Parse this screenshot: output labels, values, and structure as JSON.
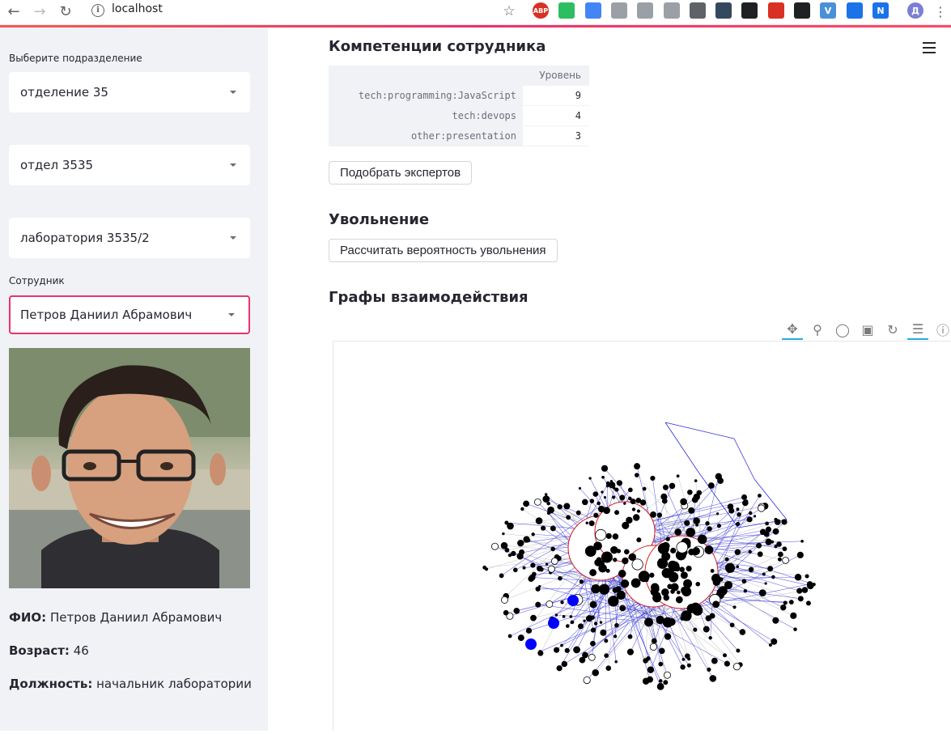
{
  "browser": {
    "url": "localhost",
    "extensions": [
      {
        "name": "adblock-icon",
        "label": "ABP",
        "color": "#d93025"
      },
      {
        "name": "evernote-icon",
        "label": "",
        "color": "#2dbe60"
      },
      {
        "name": "translate-icon",
        "label": "",
        "color": "#4285f4"
      },
      {
        "name": "vivaldi-icon",
        "label": "",
        "color": "#9aa0a6"
      },
      {
        "name": "star-plus-icon",
        "label": "",
        "color": "#9aa0a6"
      },
      {
        "name": "rss-icon",
        "label": "",
        "color": "#9aa0a6"
      },
      {
        "name": "ublock-icon",
        "label": "",
        "color": "#5f6368"
      },
      {
        "name": "spy-icon",
        "label": "",
        "color": "#34495e"
      },
      {
        "name": "crop-icon",
        "label": "",
        "color": "#202124"
      },
      {
        "name": "mega-icon",
        "label": "",
        "color": "#d93025"
      },
      {
        "name": "scissors-icon",
        "label": "",
        "color": "#202124"
      },
      {
        "name": "v-icon",
        "label": "V",
        "color": "#4a90d9"
      },
      {
        "name": "cloud-icon",
        "label": "",
        "color": "#1a73e8"
      },
      {
        "name": "notion-icon",
        "label": "N",
        "color": "#1a73e8"
      }
    ],
    "profile_initial": "Д"
  },
  "sidebar": {
    "division_label": "Выберите подразделение",
    "division_value": "отделение 35",
    "department_value": "отдел 3535",
    "lab_value": "лаборатория 3535/2",
    "employee_label": "Сотрудник",
    "employee_value": "Петров Даниил Абрамович",
    "fio_key": "ФИО:",
    "fio_value": "Петров Даниил Абрамович",
    "age_key": "Возраст:",
    "age_value": "46",
    "position_key": "Должность:",
    "position_value": "начальник лаборатории"
  },
  "main": {
    "competencies_title": "Компетенции сотрудника",
    "table_header": "Уровень",
    "table_rows": [
      {
        "skill": "tech:programming:JavaScript",
        "level": "9"
      },
      {
        "skill": "tech:devops",
        "level": "4"
      },
      {
        "skill": "other:presentation",
        "level": "3"
      }
    ],
    "find_experts_label": "Подобрать экспертов",
    "dismissal_title": "Увольнение",
    "dismissal_button_label": "Рассчитать вероятность увольнения",
    "graphs_title": "Графы взаимодействия",
    "graph_tools": [
      "pan-icon",
      "box-zoom-icon",
      "wheel-zoom-icon",
      "save-icon",
      "reset-icon",
      "hover-icon",
      "help-icon"
    ]
  }
}
